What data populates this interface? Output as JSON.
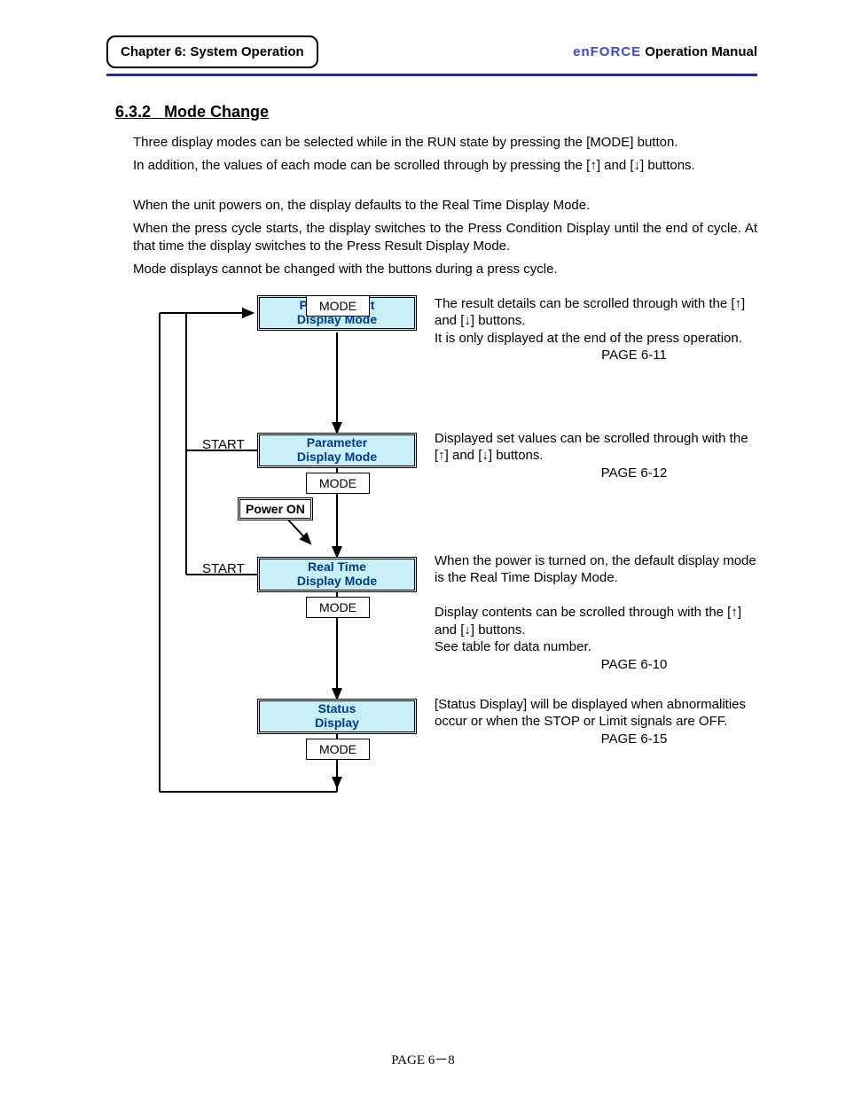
{
  "header": {
    "chapter": "Chapter 6: System Operation",
    "brand": "enFORCE",
    "manual": " Operation Manual"
  },
  "section": {
    "number": "6.3.2",
    "title": "Mode Change"
  },
  "intro": {
    "p1a": "Three display modes can be selected while in the RUN state by pressing the [MODE] button.",
    "p1b": "In addition, the values of each mode can be scrolled through by pressing the [↑] and [↓] buttons.",
    "p2a": "When the unit powers on, the display defaults to the Real Time Display Mode.",
    "p2b": "When the press cycle starts, the display switches to the Press Condition Display until the end of cycle. At that time the display switches to the Press Result Display Mode.",
    "p2c": "Mode displays cannot be changed with the buttons during a press cycle."
  },
  "flow": {
    "boxes": {
      "press_result": "Press Result\nDisplay Mode",
      "parameter": "Parameter\nDisplay Mode",
      "real_time": "Real Time\nDisplay Mode",
      "status": "Status\nDisplay"
    },
    "mode_label": "MODE",
    "power_on": "Power ON",
    "start_label": "START"
  },
  "descriptions": {
    "press_result": {
      "l1": "The result details can be scrolled through with the [↑] and [↓] buttons.",
      "l2": "It is only displayed at the end of the press operation.",
      "page": "PAGE 6-11"
    },
    "parameter": {
      "l1": "Displayed set values can be scrolled through with the [↑] and [↓] buttons.",
      "page": "PAGE 6-12"
    },
    "real_time": {
      "l1": "When the power is turned on, the default display mode is the Real Time Display Mode.",
      "l2": "Display contents can be scrolled through with the [↑] and [↓] buttons.",
      "l3": "See table for data number.",
      "page": "PAGE 6-10"
    },
    "status": {
      "l1": "[Status Display] will be displayed when abnormalities occur or when the STOP or Limit signals are OFF.",
      "page": "PAGE 6-15"
    }
  },
  "footer": "PAGE 6－8"
}
